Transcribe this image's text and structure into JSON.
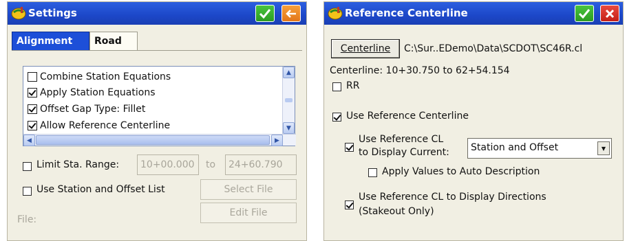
{
  "left": {
    "title": "Settings",
    "tabs": [
      "Alignment",
      "Road"
    ],
    "list_items": [
      {
        "label": "Combine Station Equations",
        "checked": false
      },
      {
        "label": "Apply Station Equations",
        "checked": true
      },
      {
        "label": "Offset Gap Type: Fillet",
        "checked": true
      },
      {
        "label": "Allow Reference Centerline",
        "checked": true
      }
    ],
    "limit_label": "Limit Sta. Range:",
    "range_from": "10+00.000",
    "range_to_label": "to",
    "range_to": "24+60.790",
    "station_offset_label": "Use Station and Offset List",
    "select_file": "Select File",
    "edit_file": "Edit File",
    "file_label": "File:"
  },
  "right": {
    "title": "Reference Centerline",
    "centerline_button": "Centerline",
    "centerline_path": "C:\\Sur..EDemo\\Data\\SCDOT\\SC46R.cl",
    "centerline_range": "Centerline: 10+30.750 to 62+54.154",
    "rr_label": "RR",
    "use_ref_label": "Use Reference Centerline",
    "display_current_line1": "Use Reference CL",
    "display_current_line2": "to Display Current:",
    "display_current_value": "Station and Offset",
    "apply_values_label": "Apply Values to Auto Description",
    "display_directions_line1": "Use Reference CL to Display Directions",
    "display_directions_line2": "(Stakeout Only)"
  },
  "colors": {
    "titlebar": "#1c47c8",
    "accept": "#2c9c22",
    "back": "#e2761a",
    "close": "#c41f17"
  },
  "icons": [
    "app-icon",
    "check-icon",
    "back-arrow-icon",
    "close-icon"
  ]
}
